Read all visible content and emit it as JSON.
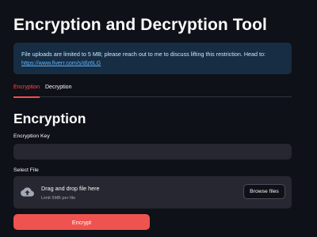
{
  "page": {
    "title": "Encryption and Decryption Tool"
  },
  "info_box": {
    "text": "File uploads are limited to 5 MB; please reach out to me to discuss lifting this restriction. Head to: ",
    "link_text": "https://www.fiverr.com/s/dlz6LG"
  },
  "tabs": [
    {
      "label": "Encryption",
      "active": true
    },
    {
      "label": "Decryption",
      "active": false
    }
  ],
  "section": {
    "title": "Encryption"
  },
  "form": {
    "key_label": "Encryption Key",
    "key_value": "",
    "file_label": "Select File",
    "dropzone": {
      "text": "Drag and drop file here",
      "limit": "Limit 5MB per file",
      "browse_label": "Browse files",
      "icon": "cloud-upload-icon"
    },
    "submit_label": "Encrypt"
  },
  "colors": {
    "background": "#0e1117",
    "info_bg": "#172d43",
    "accent": "#ff4b4b",
    "button": "#ef5350",
    "input_bg": "#262730"
  }
}
